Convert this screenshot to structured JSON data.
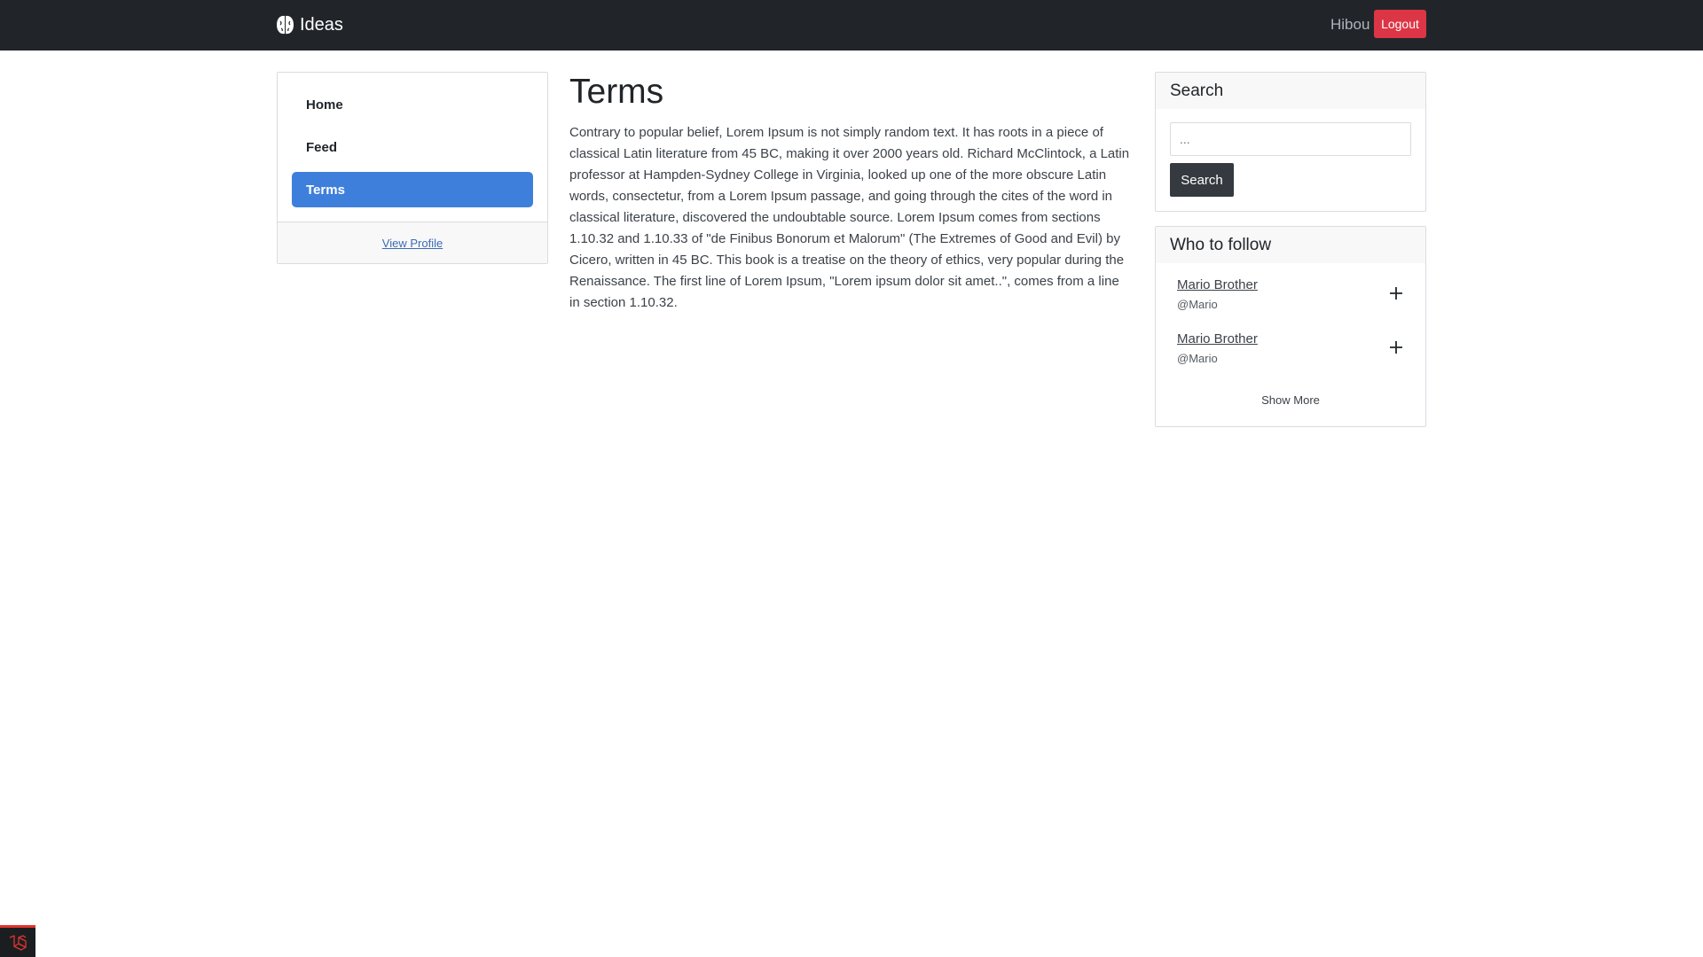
{
  "navbar": {
    "brand": "Ideas",
    "brand_icon": "brain-icon",
    "username": "Hibou",
    "logout_label": "Logout",
    "colors": {
      "background": "#212529",
      "logout": "#dc3545"
    }
  },
  "sidebar": {
    "items": [
      {
        "label": "Home",
        "active": false
      },
      {
        "label": "Feed",
        "active": false
      },
      {
        "label": "Terms",
        "active": true
      }
    ],
    "footer_link": "View Profile",
    "active_color": "#3f7fdc"
  },
  "main": {
    "title": "Terms",
    "body": "Contrary to popular belief, Lorem Ipsum is not simply random text. It has roots in a piece of classical Latin literature from 45 BC, making it over 2000 years old. Richard McClintock, a Latin professor at Hampden-Sydney College in Virginia, looked up one of the more obscure Latin words, consectetur, from a Lorem Ipsum passage, and going through the cites of the word in classical literature, discovered the undoubtable source. Lorem Ipsum comes from sections 1.10.32 and 1.10.33 of \"de Finibus Bonorum et Malorum\" (The Extremes of Good and Evil) by Cicero, written in 45 BC. This book is a treatise on the theory of ethics, very popular during the Renaissance. The first line of Lorem Ipsum, \"Lorem ipsum dolor sit amet..\", comes from a line in section 1.10.32."
  },
  "search": {
    "header": "Search",
    "placeholder": "...",
    "value": "",
    "button_label": "Search"
  },
  "follow": {
    "header": "Who to follow",
    "users": [
      {
        "name": "Mario Brother",
        "handle": "@Mario",
        "action_icon": "plus-icon"
      },
      {
        "name": "Mario Brother",
        "handle": "@Mario",
        "action_icon": "plus-icon"
      }
    ],
    "show_more": "Show More"
  },
  "debug_badge": {
    "icon": "laravel-icon",
    "color": "#e3342f"
  }
}
